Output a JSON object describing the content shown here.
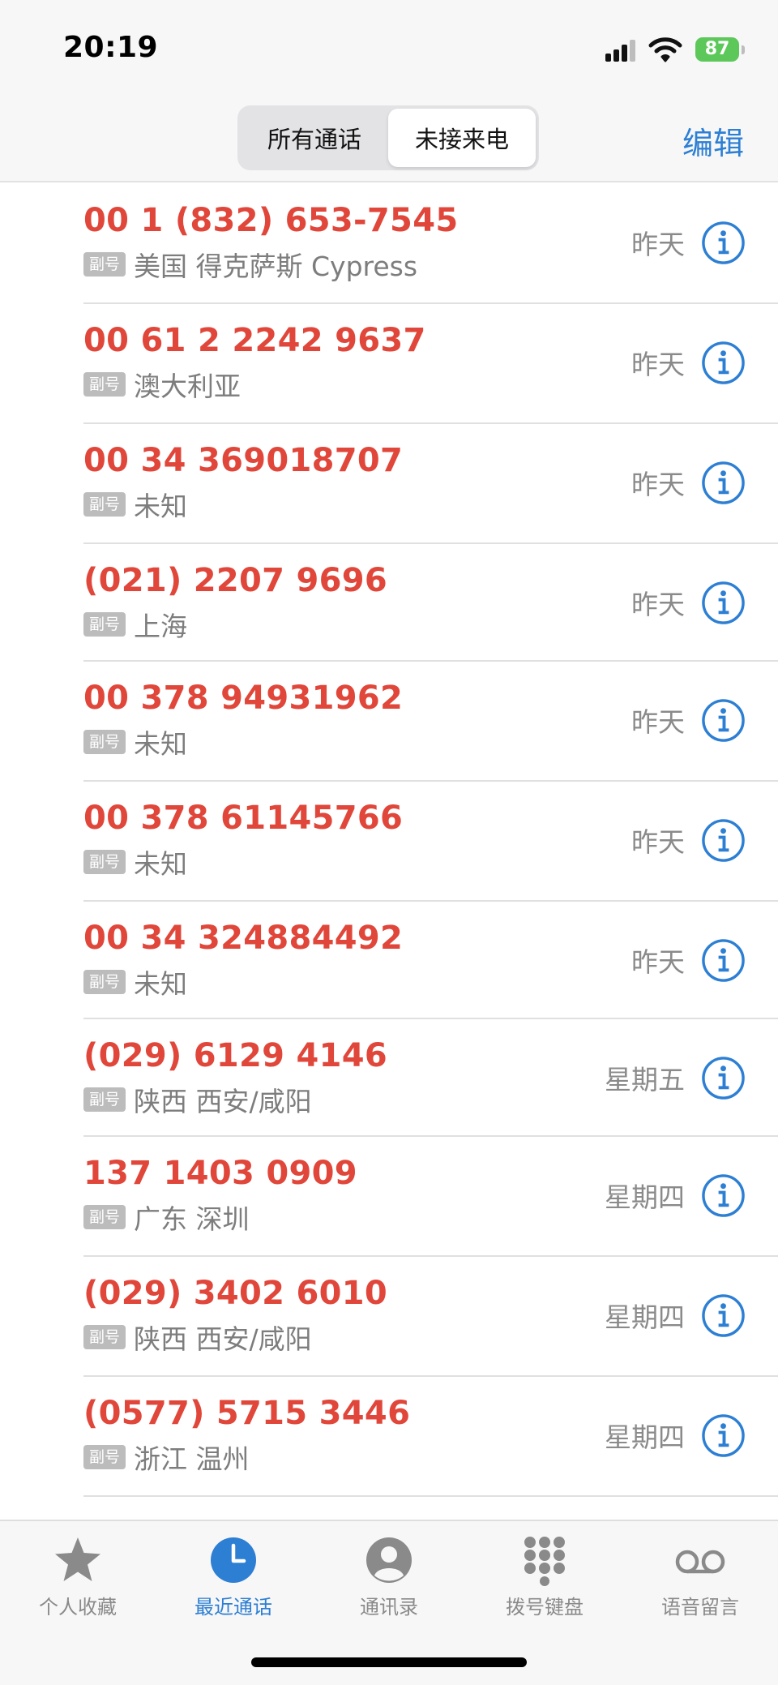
{
  "status_bar": {
    "time": "20:19",
    "battery": "87"
  },
  "header": {
    "segments": [
      "所有通话",
      "未接来电"
    ],
    "active_segment": 1,
    "edit_label": "编辑"
  },
  "badge_label": "副号",
  "calls": [
    {
      "number": "00 1 (832) 653-7545",
      "location": "美国 得克萨斯 Cypress",
      "date": "昨天"
    },
    {
      "number": "00 61 2 2242 9637",
      "location": "澳大利亚",
      "date": "昨天"
    },
    {
      "number": "00 34 369018707",
      "location": "未知",
      "date": "昨天"
    },
    {
      "number": "(021) 2207 9696",
      "location": "上海",
      "date": "昨天"
    },
    {
      "number": "00 378 94931962",
      "location": "未知",
      "date": "昨天"
    },
    {
      "number": "00 378 61145766",
      "location": "未知",
      "date": "昨天"
    },
    {
      "number": "00 34 324884492",
      "location": "未知",
      "date": "昨天"
    },
    {
      "number": "(029) 6129 4146",
      "location": "陕西 西安/咸阳",
      "date": "星期五"
    },
    {
      "number": "137 1403 0909",
      "location": "广东 深圳",
      "date": "星期四"
    },
    {
      "number": "(029) 3402 6010",
      "location": "陕西 西安/咸阳",
      "date": "星期四"
    },
    {
      "number": "(0577) 5715 3446",
      "location": "浙江 温州",
      "date": "星期四"
    }
  ],
  "tabs": [
    {
      "label": "个人收藏",
      "icon": "star-icon"
    },
    {
      "label": "最近通话",
      "icon": "clock-icon"
    },
    {
      "label": "通讯录",
      "icon": "contact-icon"
    },
    {
      "label": "拨号键盘",
      "icon": "keypad-icon"
    },
    {
      "label": "语音留言",
      "icon": "voicemail-icon"
    }
  ],
  "active_tab": 1,
  "colors": {
    "missed_red": "#e0473a",
    "accent_blue": "#2d7fd4",
    "secondary_gray": "#8a8a8a",
    "battery_green": "#5dc85a"
  }
}
